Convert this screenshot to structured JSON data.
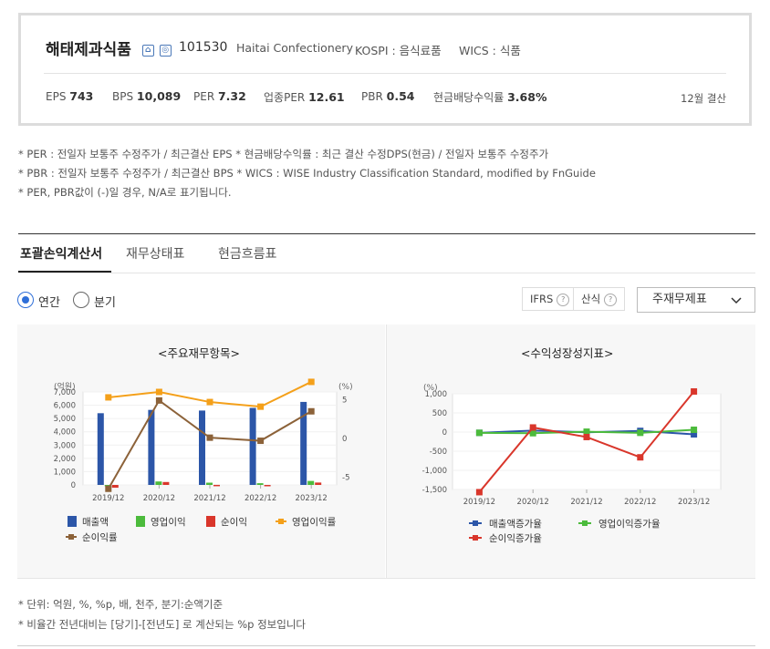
{
  "company": {
    "name": "해태제과식품",
    "code": "101530",
    "name_en": "Haitai Confectionery",
    "market": "KOSPI : 음식료품",
    "wics": "WICS : 식품"
  },
  "metrics": {
    "eps_label": "EPS",
    "eps": "743",
    "bps_label": "BPS",
    "bps": "10,089",
    "per_label": "PER",
    "per": "7.32",
    "sector_per_label": "업종PER",
    "sector_per": "12.61",
    "pbr_label": "PBR",
    "pbr": "0.54",
    "div_label": "현금배당수익률",
    "div": "3.68%",
    "settlement": "12월 결산"
  },
  "notes": [
    "* PER : 전일자 보통주 수정주가 / 최근결산 EPS * 현금배당수익률 : 최근 결산 수정DPS(현금) / 전일자 보통주 수정주가",
    "* PBR : 전일자 보통주 수정주가 / 최근결산 BPS * WICS : WISE Industry Classification Standard, modified by FnGuide",
    "* PER, PBR값이 (-)일 경우, N/A로 표기됩니다."
  ],
  "tabs": [
    "포괄손익계산서",
    "재무상태표",
    "현금흐름표"
  ],
  "period": {
    "annual": "연간",
    "quarter": "분기"
  },
  "controls": {
    "ifrs": "IFRS",
    "calc": "산식",
    "select": "주재무제표"
  },
  "chart_data": [
    {
      "type": "bar",
      "title": "<주요재무항목>",
      "ylabel": "(억원)",
      "y2label": "(%)",
      "categories": [
        "2019/12",
        "2020/12",
        "2021/12",
        "2022/12",
        "2023/12"
      ],
      "ylim": [
        0,
        7000
      ],
      "yticks": [
        "7,000",
        "6,000",
        "5,000",
        "4,000",
        "3,000",
        "2,000",
        "1,000",
        "0"
      ],
      "y2lim": [
        -6,
        6
      ],
      "y2ticks": [
        "5",
        "0",
        "-5"
      ],
      "series": [
        {
          "name": "매출액",
          "kind": "bar",
          "color": "#2c56a8",
          "values": [
            5400,
            5650,
            5600,
            5800,
            6250
          ]
        },
        {
          "name": "영업이익",
          "kind": "bar",
          "color": "#4cbb3c",
          "values": [
            -100,
            260,
            170,
            130,
            300
          ]
        },
        {
          "name": "순이익",
          "kind": "bar",
          "color": "#d9362b",
          "values": [
            -210,
            220,
            5,
            -40,
            180
          ]
        },
        {
          "name": "영업이익률",
          "kind": "line",
          "axis": "right",
          "color": "#f4a01a",
          "values": [
            5.3,
            6.0,
            4.7,
            4.1,
            7.3
          ]
        },
        {
          "name": "순이익률",
          "kind": "line",
          "axis": "right",
          "color": "#8c6239",
          "values": [
            -6.5,
            4.9,
            0.1,
            -0.3,
            3.5
          ]
        }
      ]
    },
    {
      "type": "line",
      "title": "<수익성장성지표>",
      "ylabel": "(%)",
      "categories": [
        "2019/12",
        "2020/12",
        "2021/12",
        "2022/12",
        "2023/12"
      ],
      "ylim": [
        -1500,
        1000
      ],
      "yticks": [
        "1,000",
        "500",
        "0",
        "-500",
        "-1,000",
        "-1,500"
      ],
      "series": [
        {
          "name": "매출액증가율",
          "color": "#2c56a8",
          "values": [
            -20,
            40,
            -5,
            30,
            -60
          ]
        },
        {
          "name": "영업이익증가율",
          "color": "#4cbb3c",
          "values": [
            -20,
            -30,
            10,
            -20,
            60
          ]
        },
        {
          "name": "순이익증가율",
          "color": "#d9362b",
          "values": [
            -1570,
            120,
            -130,
            -660,
            1060
          ]
        }
      ]
    }
  ],
  "footer_notes": [
    "* 단위: 억원, %, %p, 배, 천주, 분기:순액기준",
    "* 비율간 전년대비는 [당기]-[전년도] 로 계산되는 %p 정보입니다"
  ]
}
